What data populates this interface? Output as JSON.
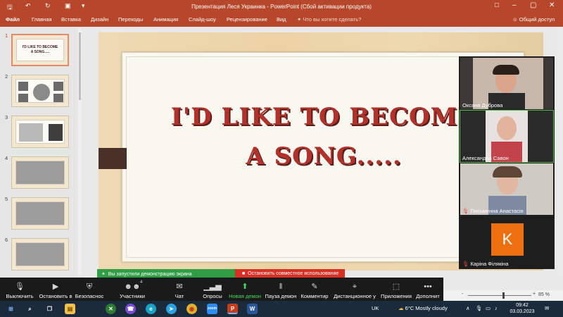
{
  "window": {
    "title": "Презентация Леся Украинка - PowerPoint (Сбой активации продукта)",
    "quick_access": {
      "save_icon": "save-icon",
      "undo_icon": "undo-icon",
      "redo_icon": "redo-icon",
      "present_icon": "present-icon"
    }
  },
  "ribbon": {
    "tabs": [
      "Файл",
      "Главная",
      "Вставка",
      "Дизайн",
      "Переходы",
      "Анимация",
      "Слайд-шоу",
      "Рецензирование",
      "Вид"
    ],
    "tell_me": "Что вы хотите сделать?",
    "share": "Общий доступ"
  },
  "thumbnails": {
    "numbers": [
      "1",
      "2",
      "3",
      "4",
      "5",
      "6"
    ],
    "first_title": "I'D LIKE TO BECOME A SONG....."
  },
  "slide": {
    "title_line1": "I'D LIKE TO BECOME",
    "title_line2": "A SONG....."
  },
  "zoom_panel": {
    "participants": [
      {
        "name": "Оксана Дуброва",
        "muted": false
      },
      {
        "name": "Александра Савон",
        "muted": false
      },
      {
        "name": "Письменна Анастасія",
        "muted": true
      },
      {
        "name": "Каріна Філякіна",
        "muted": true,
        "avatar_letter": "K"
      }
    ]
  },
  "share_banner": {
    "status": "Вы запустили демонстрацию экрана",
    "stop": "Остановить совместное использование"
  },
  "meeting_toolbar": {
    "buttons": [
      {
        "label": "Выключить",
        "icon": "microphone-icon"
      },
      {
        "label": "Остановить в",
        "icon": "video-camera-icon"
      },
      {
        "label": "Безопаснос",
        "icon": "shield-icon"
      },
      {
        "label": "Участники",
        "icon": "participants-icon",
        "count": "4"
      },
      {
        "label": "Чат",
        "icon": "chat-icon"
      },
      {
        "label": "Опросы",
        "icon": "polls-icon"
      },
      {
        "label": "Новая демон",
        "icon": "share-screen-icon"
      },
      {
        "label": "Пауза демон",
        "icon": "pause-icon"
      },
      {
        "label": "Комментир",
        "icon": "annotate-icon"
      },
      {
        "label": "Дистанционное у",
        "icon": "remote-control-icon"
      },
      {
        "label": "Приложения",
        "icon": "apps-icon"
      },
      {
        "label": "Дополнит",
        "icon": "more-icon"
      }
    ]
  },
  "statusbar": {
    "zoom": "85 %",
    "minus": "-",
    "plus": "+"
  },
  "taskbar": {
    "language": "UK",
    "weather": "6°C  Mostly cloudy",
    "time": "09:42",
    "date": "03.03.2023",
    "apps": [
      "windows-start-icon",
      "search-icon",
      "task-view-icon",
      "file-explorer-icon",
      "xbox-icon",
      "viber-icon",
      "edge-icon",
      "telegram-icon",
      "chrome-icon",
      "zoom-icon",
      "powerpoint-icon",
      "word-icon"
    ]
  },
  "colors": {
    "ppt_red": "#b7472a",
    "title_red": "#b1312b",
    "zoom_green": "#2f9e44",
    "stop_red": "#d93025",
    "avatar_orange": "#ec7010"
  }
}
